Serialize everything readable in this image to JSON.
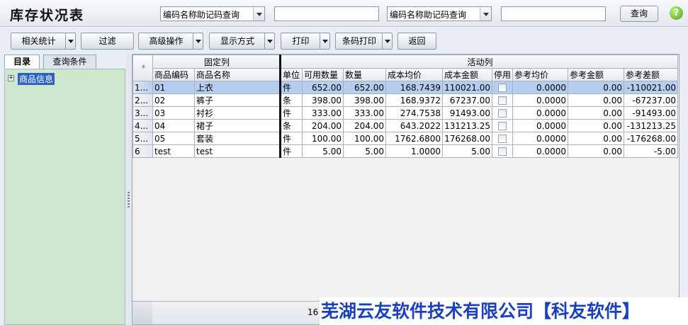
{
  "header": {
    "title": "库存状况表",
    "combo1_value": "编码名称助记码查询",
    "text1_value": "",
    "combo2_value": "编码名称助记码查询",
    "text2_value": "",
    "query_label": "查询",
    "help_glyph": "?"
  },
  "toolbar": {
    "stats_label": "相关统计",
    "filter_label": "过滤",
    "advanced_label": "高级操作",
    "display_label": "显示方式",
    "print_label": "打印",
    "barcode_label": "条码打印",
    "back_label": "返回"
  },
  "tabs": [
    {
      "label": "目录",
      "active": true
    },
    {
      "label": "查询条件",
      "active": false
    }
  ],
  "tree": {
    "expander": "+",
    "root_label": "商品信息"
  },
  "grid": {
    "band_fixed": "固定列",
    "band_active": "活动列",
    "row_header_glyph": "*",
    "columns": [
      "商品编码",
      "商品名称",
      "单位",
      "可用数量",
      "数量",
      "成本均价",
      "成本金额",
      "停用",
      "参考均价",
      "参考金额",
      "参考差额"
    ],
    "rows": [
      {
        "no": "1...",
        "code": "01",
        "name": "上衣",
        "unit": "件",
        "avail": "652.00",
        "qty": "652.00",
        "cost_avg": "168.7439",
        "cost_amt": "110021.00",
        "ref_avg": "0.0000",
        "ref_amt": "0.00",
        "ref_diff": "-110021.00",
        "selected": true
      },
      {
        "no": "2...",
        "code": "02",
        "name": "裤子",
        "unit": "条",
        "avail": "398.00",
        "qty": "398.00",
        "cost_avg": "168.9372",
        "cost_amt": "67237.00",
        "ref_avg": "0.0000",
        "ref_amt": "0.00",
        "ref_diff": "-67237.00",
        "selected": false
      },
      {
        "no": "3...",
        "code": "03",
        "name": "衬衫",
        "unit": "件",
        "avail": "333.00",
        "qty": "333.00",
        "cost_avg": "274.7538",
        "cost_amt": "91493.00",
        "ref_avg": "0.0000",
        "ref_amt": "0.00",
        "ref_diff": "-91493.00",
        "selected": false
      },
      {
        "no": "4...",
        "code": "04",
        "name": "裙子",
        "unit": "条",
        "avail": "204.00",
        "qty": "204.00",
        "cost_avg": "643.2022",
        "cost_amt": "131213.25",
        "ref_avg": "0.0000",
        "ref_amt": "0.00",
        "ref_diff": "-131213.25",
        "selected": false
      },
      {
        "no": "5...",
        "code": "05",
        "name": "套装",
        "unit": "件",
        "avail": "100.00",
        "qty": "100.00",
        "cost_avg": "1762.6800",
        "cost_amt": "176268.00",
        "ref_avg": "0.0000",
        "ref_amt": "0.00",
        "ref_diff": "-176268.00",
        "selected": false
      },
      {
        "no": "6",
        "code": "test",
        "name": "test",
        "unit": "件",
        "avail": "5.00",
        "qty": "5.00",
        "cost_avg": "1.0000",
        "cost_amt": "5.00",
        "ref_avg": "0.0000",
        "ref_amt": "0.00",
        "ref_diff": "-5.00",
        "selected": false
      }
    ],
    "footer_count": "16"
  },
  "watermark": "芜湖云友软件技术有限公司【科友软件】"
}
